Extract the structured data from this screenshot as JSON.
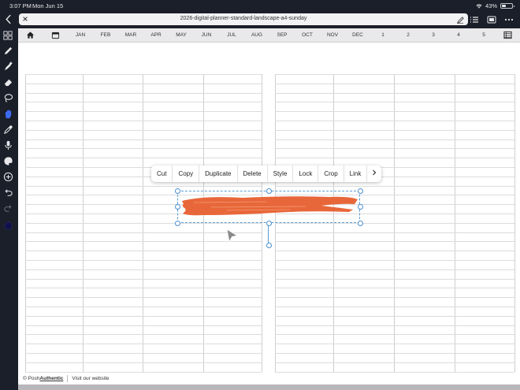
{
  "status_bar": {
    "time": "3:07 PM",
    "date": "Mon Jun 15",
    "battery": "43%"
  },
  "document": {
    "title": "2026-digital-planner-standard-landscape-a4-sunday"
  },
  "planner_tabs": [
    "JAN",
    "FEB",
    "MAR",
    "APR",
    "MAY",
    "JUN",
    "JUL",
    "AUG",
    "SEP",
    "OCT",
    "NOV",
    "DEC",
    "1",
    "2",
    "3",
    "4",
    "5"
  ],
  "context_menu": {
    "items": [
      "Cut",
      "Copy",
      "Duplicate",
      "Delete",
      "Style",
      "Lock",
      "Crop",
      "Link"
    ]
  },
  "footer": {
    "brand_prefix": "© Posh",
    "brand_bold": "Authentic",
    "link": "Visit our website"
  },
  "colors": {
    "brush_stroke": "#e8673a",
    "selection": "#5b9bd5",
    "toolbar_bg": "#1b1f29"
  },
  "icons": {
    "toolbar": [
      "grid-icon",
      "pen-icon",
      "marker-icon",
      "eraser-icon",
      "lasso-icon",
      "hand-icon",
      "eyedropper-icon",
      "microphone-icon",
      "palette-icon",
      "add-icon",
      "undo-icon",
      "redo-icon",
      "color-swatch-icon"
    ]
  }
}
